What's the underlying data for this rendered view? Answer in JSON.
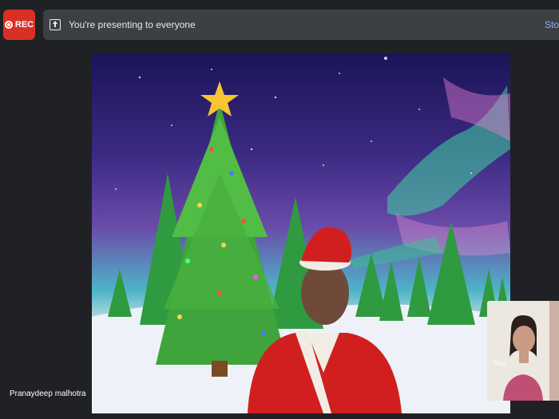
{
  "recording": {
    "label": "REC"
  },
  "presenting_bar": {
    "message": "You're presenting to everyone",
    "stop_label": "Stop presenting"
  },
  "main_participant": {
    "name": "Pranaydeep malhotra"
  },
  "self_view": {
    "label": "You"
  },
  "colors": {
    "rec": "#d93025",
    "bar": "#3c4043",
    "background": "#202124",
    "accent": "#8ab4f8"
  }
}
